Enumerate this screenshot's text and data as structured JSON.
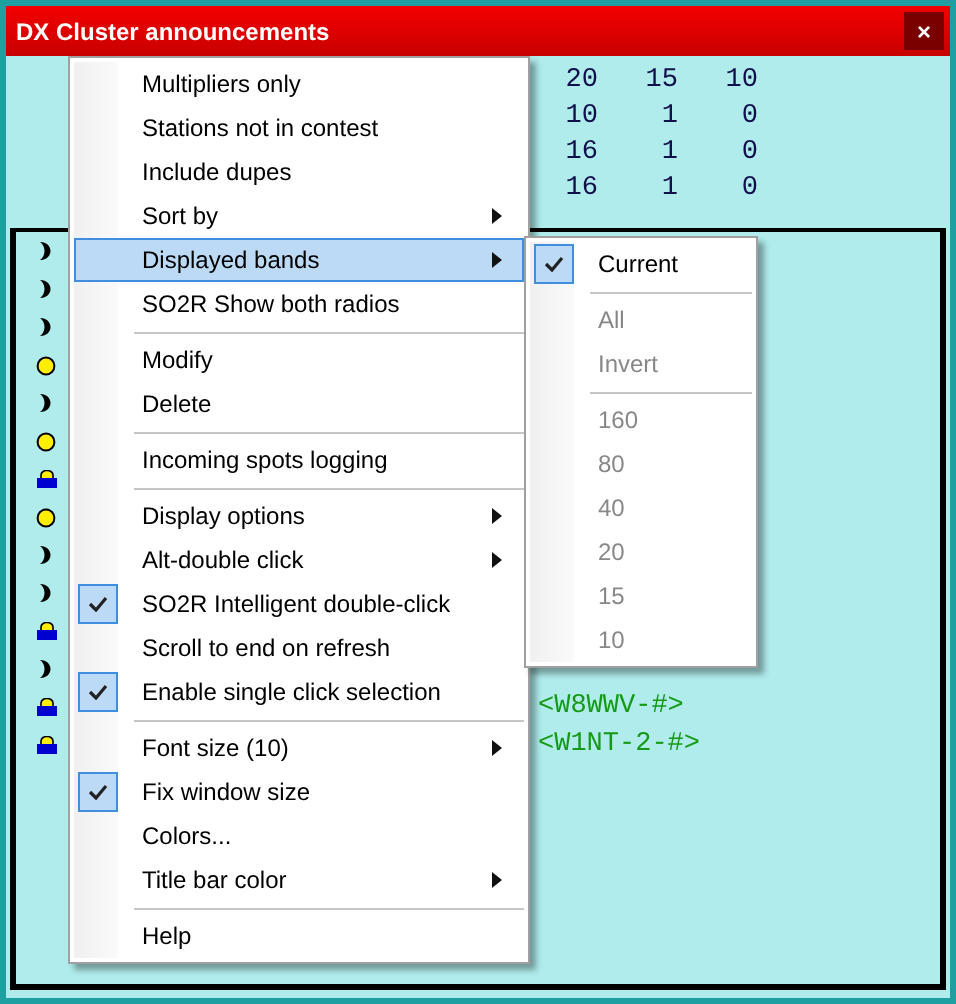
{
  "window": {
    "title": "DX Cluster announcements",
    "close": "×"
  },
  "summary_rows": [
    [
      "20",
      "15",
      "10"
    ],
    [
      "10",
      "1",
      "0"
    ],
    [
      "16",
      "1",
      "0"
    ],
    [
      "16",
      "1",
      "0"
    ]
  ],
  "spots": [
    {
      "kind": "moon"
    },
    {
      "kind": "moon"
    },
    {
      "kind": "moon"
    },
    {
      "kind": "dot"
    },
    {
      "kind": "moon"
    },
    {
      "kind": "dot"
    },
    {
      "kind": "lock"
    },
    {
      "kind": "dot"
    },
    {
      "kind": "moon"
    },
    {
      "kind": "moon"
    },
    {
      "kind": "lock"
    },
    {
      "kind": "moon"
    },
    {
      "kind": "lock",
      "source": "<W8WWV-#>"
    },
    {
      "kind": "lock",
      "source": "<W1NT-2-#>"
    }
  ],
  "menu": {
    "items": [
      {
        "kind": "item",
        "label": "Multipliers only",
        "checked": false,
        "selected": false,
        "submenu": false
      },
      {
        "kind": "item",
        "label": "Stations not in contest",
        "checked": false,
        "selected": false,
        "submenu": false
      },
      {
        "kind": "item",
        "label": "Include dupes",
        "checked": false,
        "selected": false,
        "submenu": false
      },
      {
        "kind": "item",
        "label": "Sort by",
        "checked": false,
        "selected": false,
        "submenu": true
      },
      {
        "kind": "item",
        "label": "Displayed bands",
        "checked": false,
        "selected": true,
        "submenu": true
      },
      {
        "kind": "item",
        "label": "SO2R Show both radios",
        "checked": false,
        "selected": false,
        "submenu": false
      },
      {
        "kind": "separator"
      },
      {
        "kind": "item",
        "label": "Modify",
        "checked": false,
        "selected": false,
        "submenu": false
      },
      {
        "kind": "item",
        "label": "Delete",
        "checked": false,
        "selected": false,
        "submenu": false
      },
      {
        "kind": "separator"
      },
      {
        "kind": "item",
        "label": "Incoming spots logging",
        "checked": false,
        "selected": false,
        "submenu": false
      },
      {
        "kind": "separator"
      },
      {
        "kind": "item",
        "label": "Display options",
        "checked": false,
        "selected": false,
        "submenu": true
      },
      {
        "kind": "item",
        "label": "Alt-double click",
        "checked": false,
        "selected": false,
        "submenu": true
      },
      {
        "kind": "item",
        "label": "SO2R Intelligent double-click",
        "checked": true,
        "selected": false,
        "submenu": false
      },
      {
        "kind": "item",
        "label": "Scroll to end on refresh",
        "checked": false,
        "selected": false,
        "submenu": false
      },
      {
        "kind": "item",
        "label": "Enable single click selection",
        "checked": true,
        "selected": false,
        "submenu": false
      },
      {
        "kind": "separator"
      },
      {
        "kind": "item",
        "label": "Font size (10)",
        "checked": false,
        "selected": false,
        "submenu": true
      },
      {
        "kind": "item",
        "label": "Fix window size",
        "checked": true,
        "selected": false,
        "submenu": false
      },
      {
        "kind": "item",
        "label": "Colors...",
        "checked": false,
        "selected": false,
        "submenu": false
      },
      {
        "kind": "item",
        "label": "Title bar color",
        "checked": false,
        "selected": false,
        "submenu": true
      },
      {
        "kind": "separator"
      },
      {
        "kind": "item",
        "label": "Help",
        "checked": false,
        "selected": false,
        "submenu": false
      }
    ]
  },
  "bands_submenu": {
    "items": [
      {
        "kind": "item",
        "label": "Current",
        "checked": true,
        "disabled": false
      },
      {
        "kind": "separator"
      },
      {
        "kind": "item",
        "label": "All",
        "checked": false,
        "disabled": true
      },
      {
        "kind": "item",
        "label": "Invert",
        "checked": false,
        "disabled": true
      },
      {
        "kind": "separator"
      },
      {
        "kind": "item",
        "label": "160",
        "checked": false,
        "disabled": true
      },
      {
        "kind": "item",
        "label": "80",
        "checked": false,
        "disabled": true
      },
      {
        "kind": "item",
        "label": "40",
        "checked": false,
        "disabled": true
      },
      {
        "kind": "item",
        "label": "20",
        "checked": false,
        "disabled": true
      },
      {
        "kind": "item",
        "label": "15",
        "checked": false,
        "disabled": true
      },
      {
        "kind": "item",
        "label": "10",
        "checked": false,
        "disabled": true
      }
    ]
  }
}
